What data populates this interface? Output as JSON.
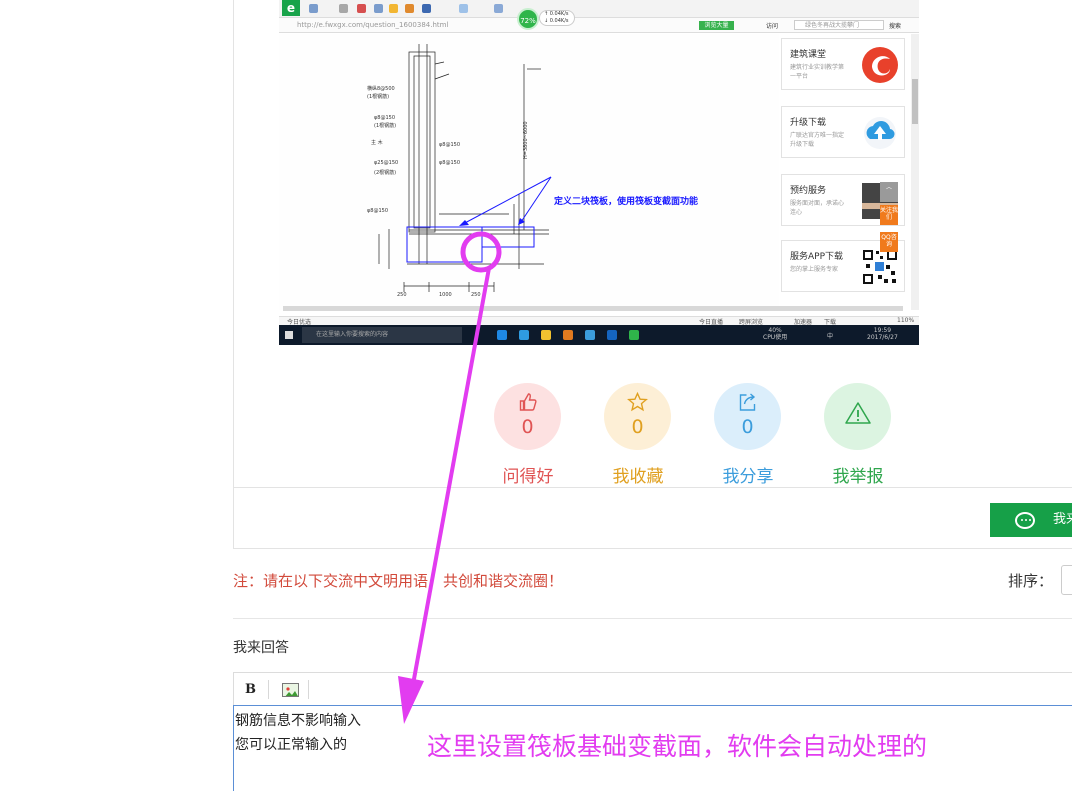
{
  "browser": {
    "url": "http://e.fwxgx.com/question_1600384.html",
    "cpu_badge": "72%",
    "speed_up": "↑ 0.04K/s",
    "speed_down": "↓ 0.04K/s",
    "search_placeholder": "绿色冬再战大揽攀门",
    "visit_label": "访问",
    "search_button": "搜索",
    "nav_label": "浏览大量",
    "status_left": "今日优选",
    "status_items": [
      "今日直播",
      "跨屏浏览",
      "加速器",
      "下载"
    ],
    "zoom": "110%"
  },
  "drawing": {
    "callout": "定义二块筏板，使用筏板变截面功能",
    "dims": [
      "250",
      "1000",
      "250"
    ]
  },
  "sidebar": {
    "cards": [
      {
        "title": "建筑课堂",
        "desc": "建筑行业实训教学第一平台"
      },
      {
        "title": "升级下载",
        "desc": "广联达官方唯一指定升级下载"
      },
      {
        "title": "预约服务",
        "desc": "服务面对面，承诺心连心"
      },
      {
        "title": "服务APP下载",
        "desc": "您的掌上服务专家"
      }
    ],
    "float_follow": "关注我们",
    "float_qq": "QQ咨询"
  },
  "taskbar": {
    "search_placeholder": "在这里输入你要搜索的内容",
    "cpu": "40%",
    "cpu_label": "CPU使用",
    "tray_lang": "中",
    "time": "19:59",
    "date": "2017/6/27"
  },
  "actions": [
    {
      "label": "问得好",
      "count": "0",
      "icon": "thumbs-up-icon",
      "color": "#e05454",
      "bg": "#fde1e1"
    },
    {
      "label": "我收藏",
      "count": "0",
      "icon": "star-icon",
      "color": "#e0a020",
      "bg": "#fdefd6"
    },
    {
      "label": "我分享",
      "count": "0",
      "icon": "share-icon",
      "color": "#3c9ddc",
      "bg": "#dbeefb"
    },
    {
      "label": "我举报",
      "count": "0",
      "icon": "warning-icon",
      "color": "#2fa64d",
      "bg": "#dcf4e1"
    }
  ],
  "answer_button": "我来",
  "notice": "注：请在以下交流中文明用语，共创和谐交流圈！",
  "sort_label": "排序：",
  "answer_title": "我来回答",
  "editor": {
    "bold_label": "B",
    "line1": "钢筋信息不影响输入",
    "line2": "您可以正常输入的"
  },
  "overlay_note": "这里设置筏板基础变截面，软件会自动处理的",
  "colors": {
    "arrow": "#e23cf0",
    "primary_green": "#16a048",
    "notice_red": "#d24a3b",
    "editor_border": "#5b8fd6"
  }
}
